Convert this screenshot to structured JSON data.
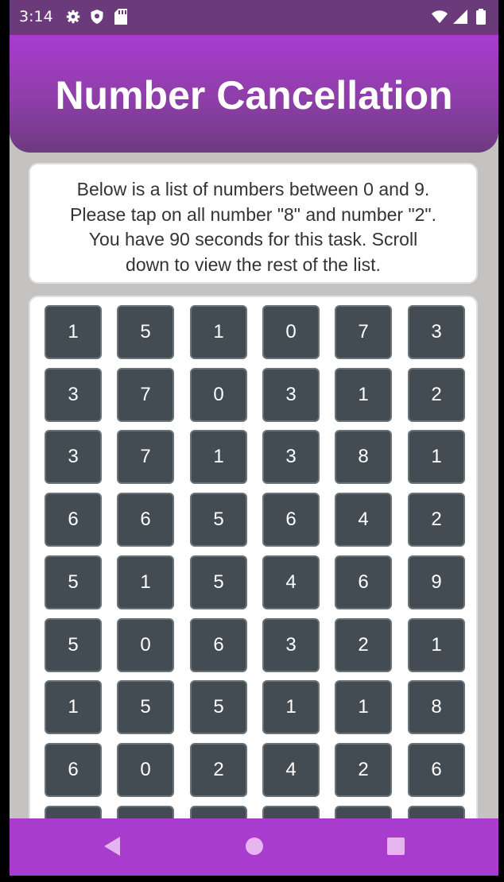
{
  "status": {
    "time": "3:14",
    "left_icons": [
      "gear-icon",
      "shield-icon",
      "sd-card-icon"
    ],
    "right_icons": [
      "wifi-icon",
      "signal-icon",
      "battery-icon"
    ]
  },
  "header": {
    "title": "Number Cancellation"
  },
  "instructions": {
    "lines": [
      "Below is a list of numbers between 0 and 9.",
      "Please tap on all number \"8\" and number \"2\".",
      "You have 90 seconds for this task. Scroll",
      "down to view the rest of the list."
    ]
  },
  "grid": {
    "rows": [
      [
        "1",
        "5",
        "1",
        "0",
        "7",
        "3"
      ],
      [
        "3",
        "7",
        "0",
        "3",
        "1",
        "2"
      ],
      [
        "3",
        "7",
        "1",
        "3",
        "8",
        "1"
      ],
      [
        "6",
        "6",
        "5",
        "6",
        "4",
        "2"
      ],
      [
        "5",
        "1",
        "5",
        "4",
        "6",
        "9"
      ],
      [
        "5",
        "0",
        "6",
        "3",
        "2",
        "1"
      ],
      [
        "1",
        "5",
        "5",
        "1",
        "1",
        "8"
      ],
      [
        "6",
        "0",
        "2",
        "4",
        "2",
        "6"
      ],
      [
        "",
        "",
        "",
        "",
        "",
        ""
      ]
    ]
  },
  "navbar": {
    "back": "back-icon",
    "home": "home-icon",
    "recents": "recents-icon"
  },
  "colors": {
    "header": "#a83ccf",
    "button": "#434c53",
    "background": "#c5c2c2"
  }
}
